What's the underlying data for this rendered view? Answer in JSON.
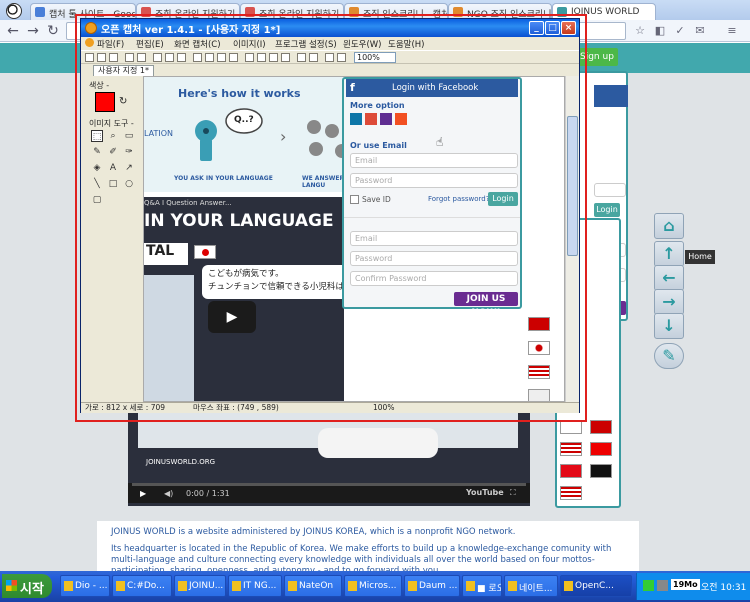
{
  "browser": {
    "tabs": [
      {
        "label": "캡처 툴 사이트 - Google",
        "fav_color": "#4a7fd8"
      },
      {
        "label": "조회 온라인 지원하기 -",
        "fav_color": "#d9534f"
      },
      {
        "label": "조회 온라인 지원하기 -",
        "fav_color": "#d9534f"
      },
      {
        "label": "조직 인스크리니 - 캡처",
        "fav_color": "#e08a2e"
      },
      {
        "label": "NGO 조직 인스크리니",
        "fav_color": "#e08a2e"
      },
      {
        "label": "JOINUS WORLD",
        "fav_color": "#3b9aa0"
      }
    ],
    "nav": {
      "back": "←",
      "forward": "→",
      "reload": "↻"
    },
    "toolbar_icons": [
      "☆",
      "◧",
      "✓",
      "✉",
      "≡"
    ]
  },
  "site": {
    "signup_label": "Sign up",
    "home_tooltip": "Home",
    "nav_arrows": [
      "⌂",
      "↑",
      "←",
      "→",
      "↓",
      "✎"
    ],
    "login_label": "Login",
    "join_label": "JOIN US NOW!",
    "video_url": "JOINUSWORLD.ORG",
    "video_time": "0:00 / 1:31",
    "video_brand": "YouTube",
    "about_lines": [
      "JOINUS WORLD is a website administered by JOINUS KOREA, which is a nonprofit NGO network.",
      "Its headquarter is located in the Republic of Korea. We make efforts to build up a knowledge-exchange comunity with multi-language and culture connecting every knowledge with individuals all over the world based on four mottos-participation, sharing, openness, and autonomy - and to go forward with you."
    ]
  },
  "capture": {
    "title": "오픈 캡처 ver 1.4.1 - [사용자 지정 1*]",
    "menu": [
      "파일(F)",
      "편집(E)",
      "화면 캡처(C)",
      "이미지(I)",
      "프로그램 설정(S)",
      "윈도우(W)",
      "도움말(H)"
    ],
    "zoom": "100%",
    "tab_label": "사용자 지정 1*",
    "palette": {
      "color_label": "색상 -",
      "tools_label": "이미지 도구 -",
      "selected_color": "#ff0000"
    },
    "status": {
      "size": "가로 : 812 x 세로 : 709",
      "mouse": "마우스 좌표 : (749 , 589)",
      "zoom": "100%"
    },
    "canvas": {
      "how_title": "Here's how it works",
      "how_text_fragment": "LATION",
      "ask_label": "YOU ASK IN YOUR LANGUAGE",
      "answer_label": "WE ANSWER IN LANGU",
      "bubble": "Q..?",
      "video_header": "Q&A I Question Answer...",
      "video_headline": "IN YOUR LANGUAGE",
      "tal_text": "TAL",
      "jp_line1": "こどもが病気です。",
      "jp_line2": "チュンチョンで信頼できる小児科はどこですか？",
      "facebook": "Login with Facebook",
      "more_option": "More option",
      "or_email": "Or use Email",
      "email_ph": "Email",
      "password_ph": "Password",
      "save_id": "Save ID",
      "forgot": "Forgot password?",
      "login": "Login",
      "confirm_ph": "Confirm Password",
      "join": "JOIN US NOW!"
    }
  },
  "taskbar": {
    "start": "시작",
    "tasks": [
      "Dio - ...",
      "C:#Do...",
      "JOINU...",
      "IT NG...",
      "NateOn",
      "Micros...",
      "Daum ...",
      "■ 로오리",
      "네이트...",
      "OpenC..."
    ],
    "tray_time": "오전 10:31",
    "tray_badge": "19Mo"
  }
}
